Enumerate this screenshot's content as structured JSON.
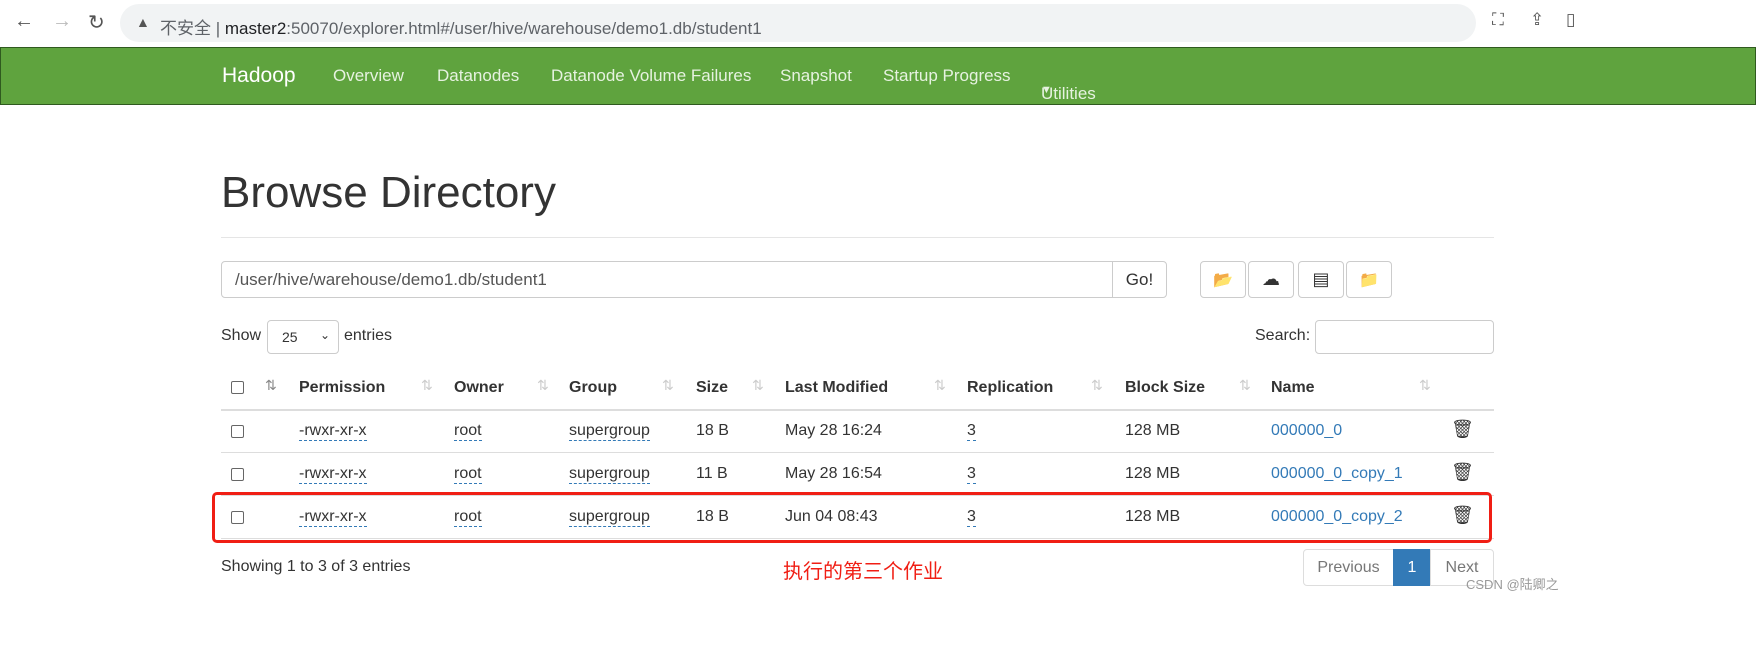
{
  "browser": {
    "insecure_label": "不安全",
    "url_host": "master2",
    "url_rest": ":50070/explorer.html#/user/hive/warehouse/demo1.db/student1"
  },
  "navbar": {
    "brand": "Hadoop",
    "items": [
      "Overview",
      "Datanodes",
      "Datanode Volume Failures",
      "Snapshot",
      "Startup Progress",
      "Utilities"
    ]
  },
  "page": {
    "title": "Browse Directory",
    "path": "/user/hive/warehouse/demo1.db/student1",
    "go_label": "Go!",
    "show_label": "Show",
    "entries_value": "25",
    "entries_label": "entries",
    "search_label": "Search:"
  },
  "table": {
    "headers": [
      "Permission",
      "Owner",
      "Group",
      "Size",
      "Last Modified",
      "Replication",
      "Block Size",
      "Name"
    ],
    "rows": [
      {
        "permission": "-rwxr-xr-x",
        "owner": "root",
        "group": "supergroup",
        "size": "18 B",
        "modified": "May 28 16:24",
        "replication": "3",
        "block_size": "128 MB",
        "name": "000000_0"
      },
      {
        "permission": "-rwxr-xr-x",
        "owner": "root",
        "group": "supergroup",
        "size": "11 B",
        "modified": "May 28 16:54",
        "replication": "3",
        "block_size": "128 MB",
        "name": "000000_0_copy_1"
      },
      {
        "permission": "-rwxr-xr-x",
        "owner": "root",
        "group": "supergroup",
        "size": "18 B",
        "modified": "Jun 04 08:43",
        "replication": "3",
        "block_size": "128 MB",
        "name": "000000_0_copy_2"
      }
    ]
  },
  "footer": {
    "info": "Showing 1 to 3 of 3 entries",
    "previous": "Previous",
    "page": "1",
    "next": "Next"
  },
  "annotation": "执行的第三个作业",
  "watermark": "CSDN @陆卿之",
  "colors": {
    "navbar": "#5fa33e",
    "link": "#337ab7",
    "highlight": "#f01e14"
  }
}
